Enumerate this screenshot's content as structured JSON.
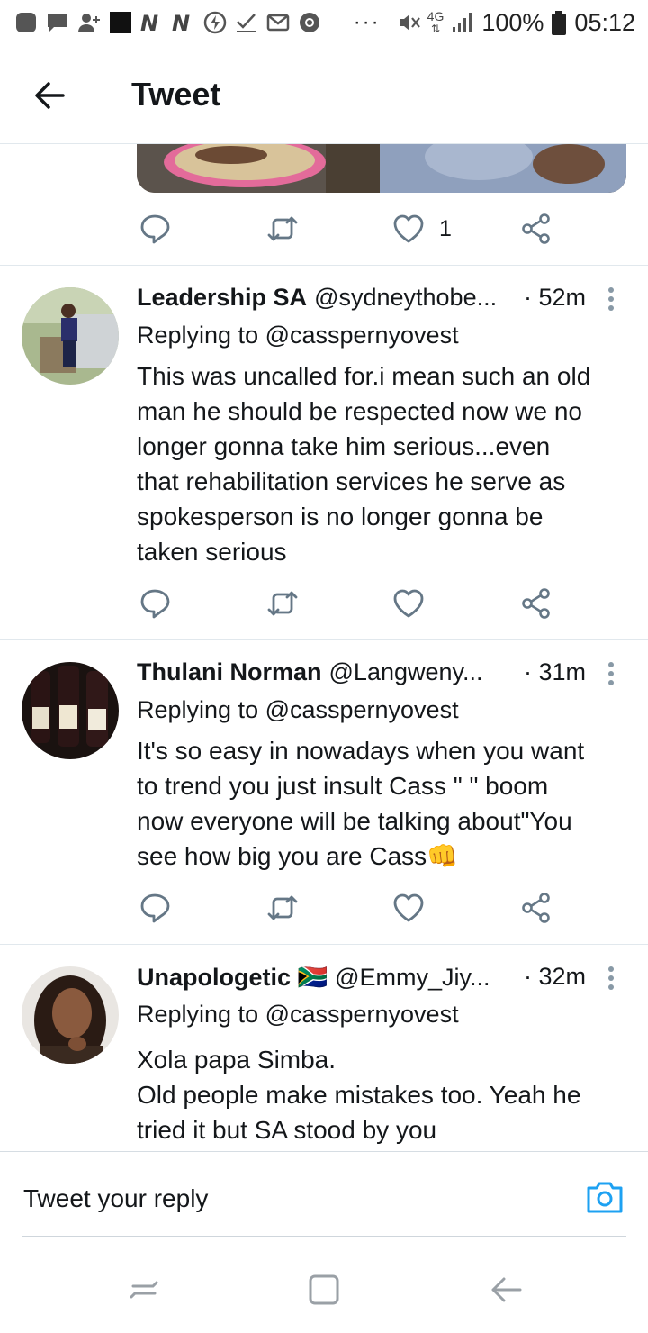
{
  "status_bar": {
    "icons": [
      "notification-icon",
      "chat-icon",
      "person-add-icon",
      "square-app-icon",
      "n-app-icon",
      "n-app-icon",
      "data-saver-icon",
      "check-icon",
      "mail-icon",
      "chrome-icon"
    ],
    "more": "···",
    "mute_icon": "vibrate-mute-icon",
    "network": "4G",
    "signal_icon": "signal-icon",
    "battery": "100%",
    "battery_icon": "battery-icon",
    "time": "05:12"
  },
  "header": {
    "back_icon": "arrow-left-icon",
    "title": "Tweet"
  },
  "top_tweet": {
    "actions": {
      "reply_icon": "reply-icon",
      "retweet_icon": "retweet-icon",
      "like_icon": "heart-icon",
      "like_count": "1",
      "share_icon": "share-icon"
    }
  },
  "replies": [
    {
      "name": "Leadership SA",
      "handle": "@sydneythobe...",
      "time": "· 52m",
      "replying_to": "Replying to @casspernyovest",
      "text": "This was uncalled for.i mean such an old\nman he should be respected now we no\nlonger gonna take him serious...even\nthat rehabilitation services he serve as\nspokesperson is no longer gonna be\ntaken serious",
      "like_count": ""
    },
    {
      "name": "Thulani Norman",
      "handle": "@Langweny...",
      "time": "· 31m",
      "replying_to": "Replying to @casspernyovest",
      "text": "It's so easy in nowadays when you want\nto trend you just insult Cass \" \" boom\nnow everyone will be talking about\"You\nsee how big you are Cass👊",
      "like_count": ""
    },
    {
      "name": "Unapologetic 🇿🇦",
      "handle": "@Emmy_Jiy...",
      "time": "· 32m",
      "replying_to": "Replying to @casspernyovest",
      "text": "Xola papa Simba.\nOld people make mistakes too. Yeah he\ntried it but SA stood by you",
      "like_count": ""
    }
  ],
  "reply_bar": {
    "placeholder": "Tweet your reply",
    "camera_icon": "camera-icon"
  },
  "nav_bar": {
    "recents_icon": "recents-icon",
    "home_icon": "home-icon",
    "back_icon": "back-icon"
  },
  "colors": {
    "accent": "#1da1f2",
    "icon_gray": "#657786",
    "text": "#14171a",
    "divider": "#e1e8ed"
  }
}
